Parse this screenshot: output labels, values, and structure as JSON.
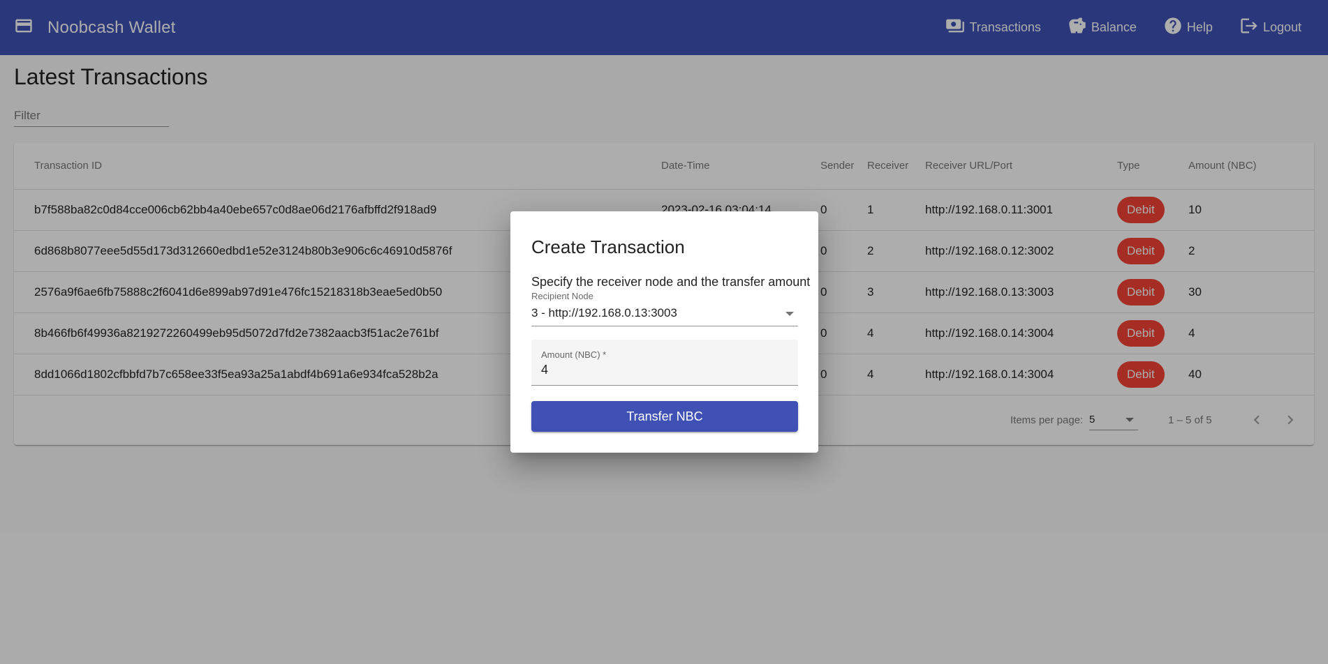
{
  "colors": {
    "primary": "#3f51b5",
    "debit": "#f44336"
  },
  "header": {
    "title": "Noobcash Wallet",
    "logo_icon": "wallet-icon",
    "nav": [
      {
        "label": "Transactions",
        "icon": "payments-icon"
      },
      {
        "label": "Balance",
        "icon": "savings-icon"
      },
      {
        "label": "Help",
        "icon": "help-icon"
      },
      {
        "label": "Logout",
        "icon": "logout-icon"
      }
    ]
  },
  "main": {
    "title": "Latest Transactions",
    "filter_placeholder": "Filter"
  },
  "table": {
    "headers": [
      "Transaction ID",
      "Date-Time",
      "Sender",
      "Receiver",
      "Receiver URL/Port",
      "Type",
      "Amount (NBC)"
    ],
    "rows": [
      {
        "id": "b7f588ba82c0d84cce006cb62bb4a40ebe657c0d8ae06d2176afbffd2f918ad9",
        "datetime": "2023-02-16 03:04:14",
        "sender": "0",
        "receiver": "1",
        "url": "http://192.168.0.11:3001",
        "type": "Debit",
        "amount": "10"
      },
      {
        "id": "6d868b8077eee5d55d173d312660edbd1e52e3124b80b3e906c6c46910d5876f",
        "datetime": "",
        "sender": "0",
        "receiver": "2",
        "url": "http://192.168.0.12:3002",
        "type": "Debit",
        "amount": "2"
      },
      {
        "id": "2576a9f6ae6fb75888c2f6041d6e899ab97d91e476fc15218318b3eae5ed0b50",
        "datetime": "",
        "sender": "0",
        "receiver": "3",
        "url": "http://192.168.0.13:3003",
        "type": "Debit",
        "amount": "30"
      },
      {
        "id": "8b466fb6f49936a8219272260499eb95d5072d7fd2e7382aacb3f51ac2e761bf",
        "datetime": "",
        "sender": "0",
        "receiver": "4",
        "url": "http://192.168.0.14:3004",
        "type": "Debit",
        "amount": "4"
      },
      {
        "id": "8dd1066d1802cfbbfd7b7c658ee33f5ea93a25a1abdf4b691a6e934fca528b2a",
        "datetime": "",
        "sender": "0",
        "receiver": "4",
        "url": "http://192.168.0.14:3004",
        "type": "Debit",
        "amount": "40"
      }
    ]
  },
  "paginator": {
    "items_per_page_label": "Items per page:",
    "page_size": "5",
    "range": "1 – 5 of 5"
  },
  "dialog": {
    "title": "Create Transaction",
    "description": "Specify the receiver node and the transfer amount",
    "recipient_label": "Recipient Node",
    "recipient_value": "3 - http://192.168.0.13:3003",
    "amount_label": "Amount (NBC) *",
    "amount_value": "4",
    "submit_label": "Transfer NBC"
  }
}
